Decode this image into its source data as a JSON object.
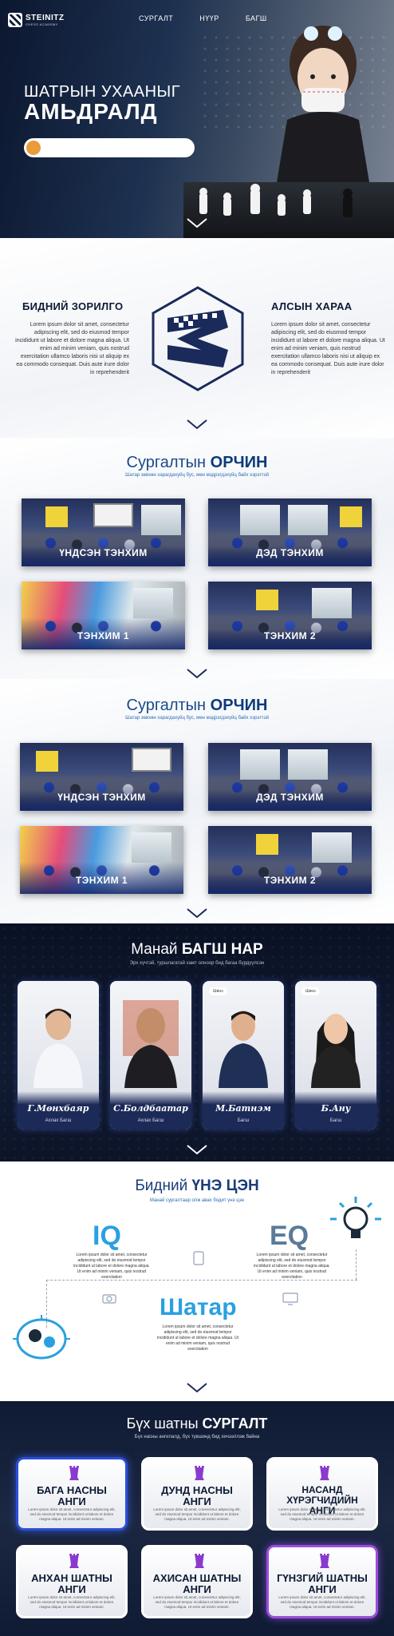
{
  "nav": {
    "logo": "STEINITZ",
    "logo_sub": "CHESS ACADEMY",
    "items": [
      "СУРГАЛТ",
      "НҮҮР",
      "БАГШ"
    ]
  },
  "hero": {
    "line1": "ШАТРЫН УХААНЫГ",
    "line2": "АМЬДРАЛД"
  },
  "mission": {
    "left_title": "БИДНИЙ ЗОРИЛГО",
    "left_text": "Lorem ipsum dolor sit amet, consectetur adipiscing elit, sed do eiusmod tempor incididunt ut labore et dolore magna aliqua. Ut enim ad minim veniam, quis nostrud exercitation ullamco laboris nisi ut aliquip ex ea commodo consequat. Duis aute irure dolor in reprehenderit",
    "right_title": "АЛСЫН ХАРАА",
    "right_text": "Lorem ipsum dolor sit amet, consectetur adipiscing elit, sed do eiusmod tempor incididunt ut labore et dolore magna aliqua. Ut enim ad minim veniam, quis nostrud exercitation ullamco laboris nisi ut aliquip ex ea commodo consequat. Duis aute irure dolor in reprehenderit"
  },
  "env1": {
    "title_light": "Сургалтын ",
    "title_bold": "ОРЧИН",
    "subtitle": "Шатар зөвхөн харагдахуйц бус, мөн мэдрэгдэхүйц байх хэрэгтэй",
    "cards": [
      "ҮНДСЭН ТЭНХИМ",
      "ДЭД ТЭНХИМ",
      "ТЭНХИМ 1",
      "ТЭНХИМ 2"
    ]
  },
  "env2": {
    "title_light": "Сургалтын ",
    "title_bold": "ОРЧИН",
    "subtitle": "Шатар зөвхөн харагдахуйц бус, мөн мэдрэгдэхүйц байх хэрэгтэй",
    "cards": [
      "ҮНДСЭН ТЭНХИМ",
      "ДЭД ТЭНХИМ",
      "ТЭНХИМ 1",
      "ТЭНХИМ 2"
    ]
  },
  "teachers": {
    "title_light": "Манай ",
    "title_bold": "БАГШ НАР",
    "subtitle": "Эрх хүчтэй, туршлагатай хамт олноор бид багаа бүрдүүлсэн",
    "badge": "Шинэ",
    "list": [
      {
        "name": "Г.Мөнхбаяр",
        "role": "Ахлах Багш"
      },
      {
        "name": "С.Болдбаатар",
        "role": "Ахлах Багш"
      },
      {
        "name": "М.Батнэм",
        "role": "Багш"
      },
      {
        "name": "Б.Ану",
        "role": "Багш"
      }
    ]
  },
  "values": {
    "title_light": "Бидний ",
    "title_bold": "ҮНЭ ЦЭН",
    "subtitle": "Манай сургалтаар олж авах бодит үнэ цэн",
    "iq": "IQ",
    "eq": "EQ",
    "shatar": "Шатар",
    "lorem": "Lorem ipsum dolor sit amet, consectetur adipiscing elit, sed do eiusmod tempor incididunt ut labore et dolore magna aliqua. Ut enim ad minim veniam, quis nostrud exercitation"
  },
  "courses": {
    "title_light": "Бүх шатны ",
    "title_bold": "СУРГАЛТ",
    "subtitle": "Бүх насны ангилалд, бүх түвшинд бид хичээллэж байна",
    "desc": "Lorem ipsum dolor sit amet, consectetur adipiscing elit, sed do eiusmod tempor incididunt ut labore et dolore magna aliqua. Ut enim ad minim veniam.",
    "list": [
      {
        "l1": "БАГА НАСНЫ",
        "l2": "АНГИ"
      },
      {
        "l1": "ДУНД НАСНЫ",
        "l2": "АНГИ"
      },
      {
        "l1": "НАСАНД ХҮРЭГЧИДИЙН",
        "l2": "АНГИ"
      },
      {
        "l1": "АНХАН ШАТНЫ",
        "l2": "АНГИ"
      },
      {
        "l1": "АХИСАН ШАТНЫ",
        "l2": "АНГИ"
      },
      {
        "l1": "ГҮНЗГИЙ ШАТНЫ",
        "l2": "АНГИ"
      }
    ]
  },
  "colors": {
    "accent": "#e89c3a",
    "brand_blue": "#1a4a8a",
    "dark_bg": "#0f1a33",
    "iq_blue": "#2aa0e0",
    "eq_steel": "#5a7a99"
  }
}
